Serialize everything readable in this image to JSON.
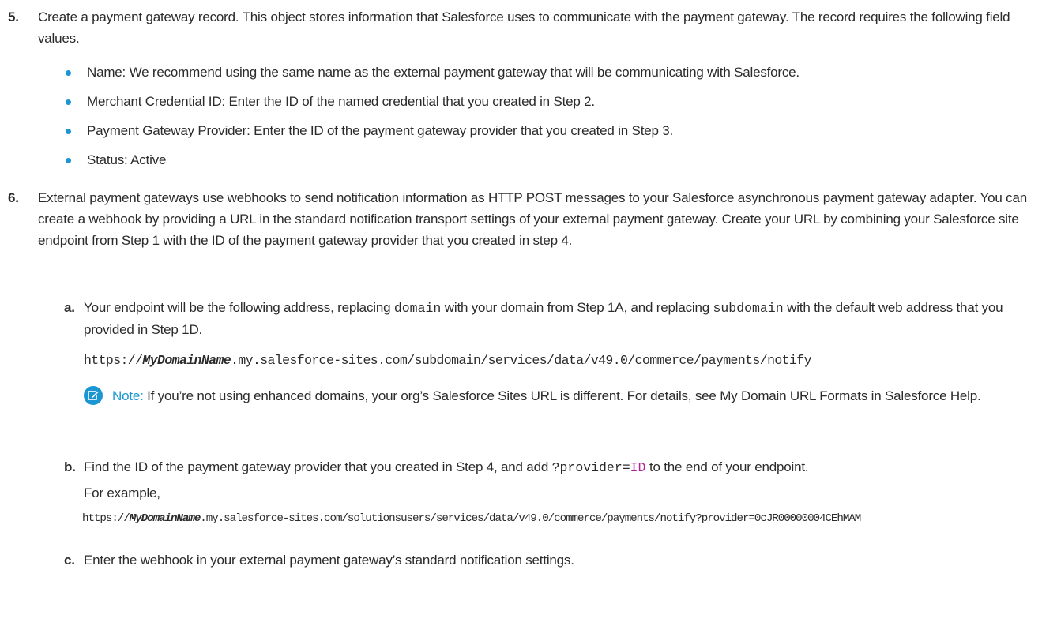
{
  "step5": {
    "number": "5.",
    "text": "Create a payment gateway record. This object stores information that Salesforce uses to communicate with the payment gateway. The record requires the following field values.",
    "bullets": [
      "Name: We recommend using the same name as the external payment gateway that will be communicating with Salesforce.",
      "Merchant Credential ID: Enter the ID of the named credential that you created in Step 2.",
      "Payment Gateway Provider: Enter the ID of the payment gateway provider that you created in Step 3.",
      "Status: Active"
    ]
  },
  "step6": {
    "number": "6.",
    "text": "External payment gateways use webhooks to send notification information as HTTP POST messages to your Salesforce asynchronous payment gateway adapter. You can create a webhook by providing a URL in the standard notification transport settings of your external payment gateway. Create your URL by combining your Salesforce site endpoint from Step 1 with the ID of the payment gateway provider that you created in step 4.",
    "a": {
      "letter": "a.",
      "text_1": "Your endpoint will be the following address, replacing ",
      "code_domain": "domain",
      "text_2": " with your domain from Step 1A, and replacing ",
      "code_subdomain": "subdomain",
      "text_3": " with the default web address that you provided in Step 1D.",
      "url_prefix": "https://",
      "url_bold": "MyDomainName",
      "url_rest": ".my.salesforce-sites.com/subdomain/services/data/v49.0/commerce/payments/notify"
    },
    "note": {
      "icon": "pencil-edit-icon",
      "label": "Note:",
      "text": " If you’re not using enhanced domains, your org’s Salesforce Sites URL is different. For details, see My Domain URL Formats in Salesforce Help."
    },
    "b": {
      "letter": "b.",
      "text_1": "Find the ID of the payment gateway provider that you created in Step 4, and add ",
      "code_param": "?provider=",
      "code_id": "ID",
      "text_2": " to the end of your endpoint.",
      "example_label": "For example,",
      "url_prefix": "https://",
      "url_bold": "MyDomainName",
      "url_rest": ".my.salesforce-sites.com/solutionsusers/services/data/v49.0/commerce/payments/notify?provider=0cJR00000004CEhMAM"
    },
    "c": {
      "letter": "c.",
      "text": "Enter the webhook in your external payment gateway’s standard notification settings."
    }
  },
  "colors": {
    "accent_blue": "#1b96d3",
    "id_magenta": "#b0219b",
    "text": "#2b2b2b"
  }
}
